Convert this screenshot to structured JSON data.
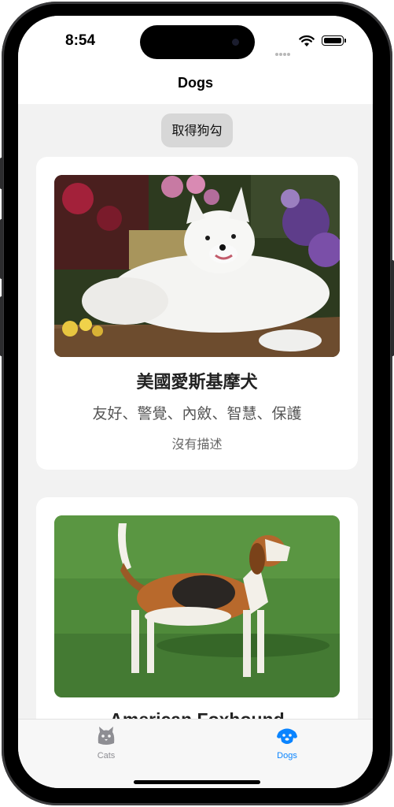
{
  "status_bar": {
    "time": "8:54"
  },
  "nav": {
    "title": "Dogs"
  },
  "fetch_button": {
    "label": "取得狗勾"
  },
  "dogs": [
    {
      "name": "美國愛斯基摩犬",
      "temperament": "友好、警覺、內斂、智慧、保護",
      "description": "沒有描述",
      "photo": "white-spitz-dog-photo"
    },
    {
      "name": "American Foxhound",
      "photo": "foxhound-dog-photo"
    }
  ],
  "tabs": [
    {
      "label": "Cats",
      "icon": "cat-icon",
      "selected": false
    },
    {
      "label": "Dogs",
      "icon": "dog-icon",
      "selected": true
    }
  ],
  "colors": {
    "accent": "#0a84ff",
    "inactive": "#8e8e93",
    "background": "#f2f2f2"
  }
}
